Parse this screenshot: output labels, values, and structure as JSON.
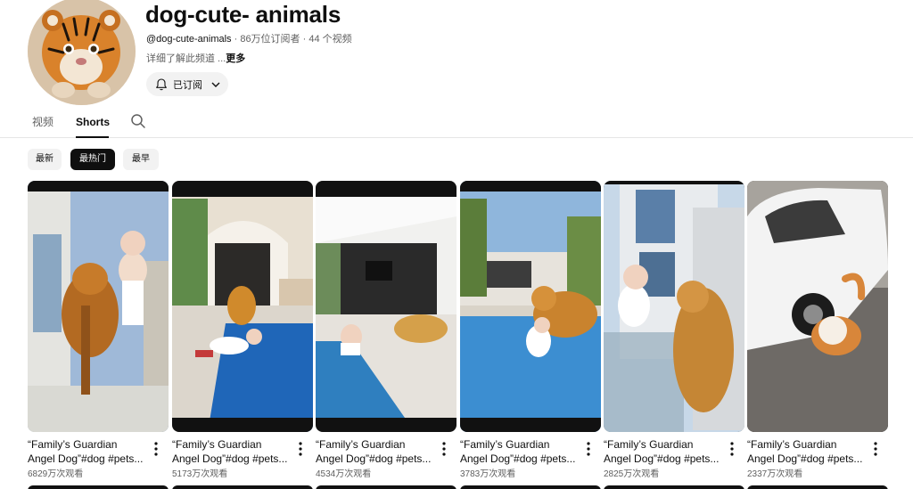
{
  "channel": {
    "name": "dog-cute- animals",
    "handle": "@dog-cute-animals",
    "stats": " · 86万位订阅者 · 44 个视频",
    "description": "详细了解此频道 ...",
    "more_label": "更多",
    "subscribe_label": "已订阅"
  },
  "tabs": [
    {
      "label": "视频"
    },
    {
      "label": "Shorts"
    }
  ],
  "chips": [
    {
      "label": "最新"
    },
    {
      "label": "最热门"
    },
    {
      "label": "最早"
    }
  ],
  "shorts": [
    {
      "title": "“Family’s Guardian\nAngel Dog”#dog #pets...",
      "views": "6829万次观看"
    },
    {
      "title": "“Family’s Guardian\nAngel Dog”#dog #pets...",
      "views": "5173万次观看"
    },
    {
      "title": "“Family’s Guardian\nAngel Dog”#dog #pets...",
      "views": "4534万次观看"
    },
    {
      "title": "“Family’s Guardian\nAngel Dog”#dog #pets...",
      "views": "3783万次观看"
    },
    {
      "title": "“Family’s Guardian\nAngel Dog”#dog #pets...",
      "views": "2825万次观看"
    },
    {
      "title": "“Family’s Guardian\nAngel Dog”#dog #pets...",
      "views": "2337万次观看"
    }
  ]
}
